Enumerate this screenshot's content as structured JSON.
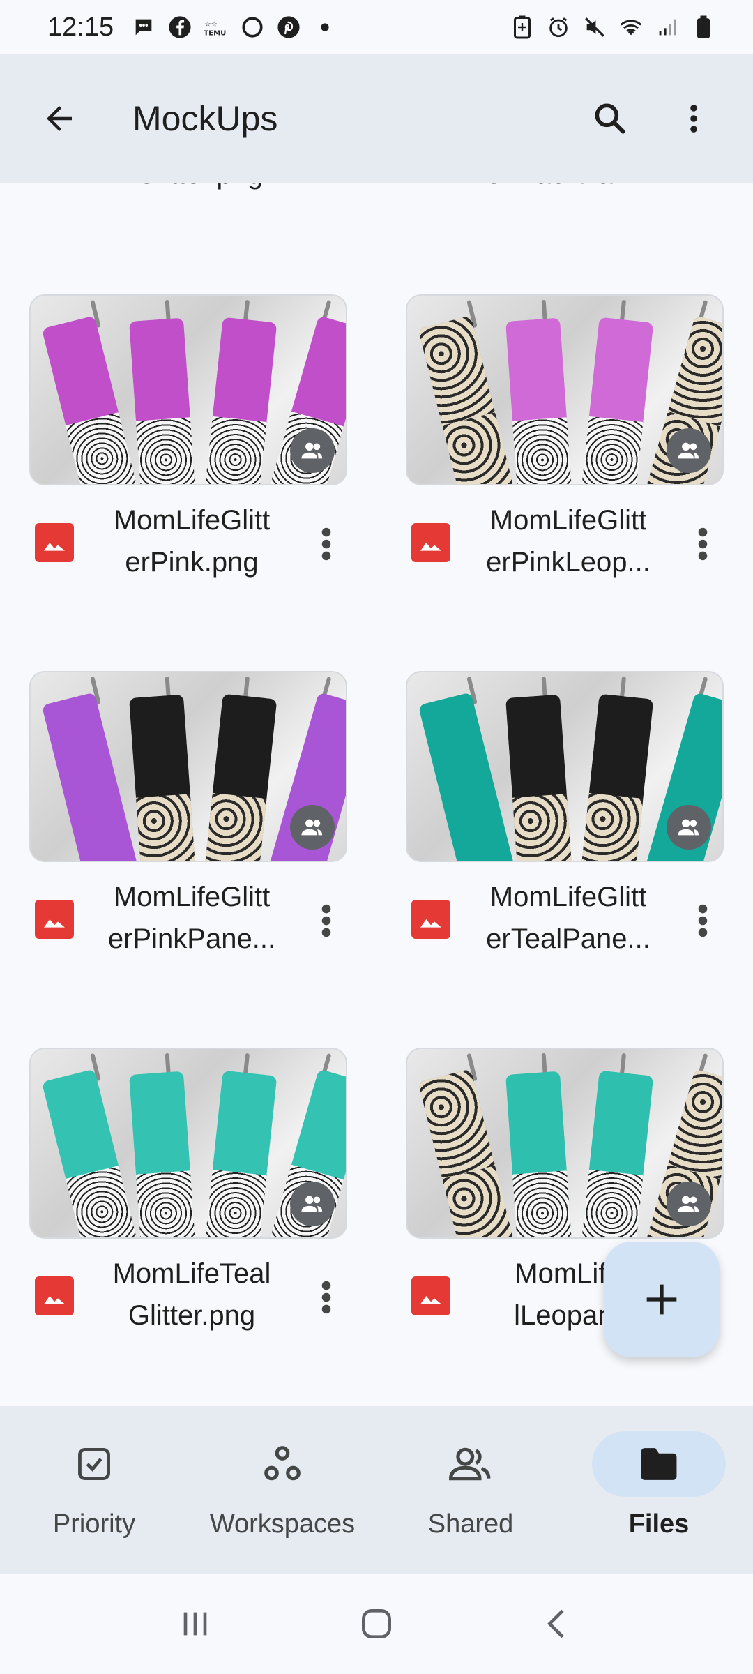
{
  "status_bar": {
    "time": "12:15",
    "notification_icons": [
      "messages-icon",
      "facebook-icon",
      "temu-icon",
      "threads-icon",
      "pinterest-icon",
      "dot-icon"
    ],
    "system_icons": [
      "battery-saver-icon",
      "alarm-icon",
      "mute-icon",
      "wifi-icon",
      "signal-icon",
      "battery-icon"
    ]
  },
  "app_bar": {
    "title": "MockUps",
    "back_icon": "arrow-back-icon",
    "search_icon": "search-icon",
    "more_icon": "more-vert-icon"
  },
  "partial_row": [
    "kGlitter.png",
    "erBlackPan..."
  ],
  "files": [
    {
      "name": "MomLifeGlitt erPink.png",
      "line1": "MomLifeGlitt",
      "line2": "erPink.png",
      "accent": "#c04fc9",
      "style": "pink"
    },
    {
      "name": "MomLifeGlitt erPinkLeop...",
      "line1": "MomLifeGlitt",
      "line2": "erPinkLeop...",
      "accent": "#d06ad6",
      "style": "pinkleopard"
    },
    {
      "name": "MomLifeGlitt erPinkPane...",
      "line1": "MomLifeGlitt",
      "line2": "erPinkPane...",
      "accent": "#a855d6",
      "style": "purplepanel"
    },
    {
      "name": "MomLifeGlitt erTealPane...",
      "line1": "MomLifeGlitt",
      "line2": "erTealPane...",
      "accent": "#13a89a",
      "style": "tealpanel"
    },
    {
      "name": "MomLifeTeal Glitter.png",
      "line1": "MomLifeTeal",
      "line2": "Glitter.png",
      "accent": "#34c2b3",
      "style": "teal"
    },
    {
      "name": "MomLife lLeopard",
      "line1": "MomLife",
      "line2": "lLeopard",
      "accent": "#2fbfae",
      "style": "tealleopard"
    }
  ],
  "fab": {
    "icon": "add-icon"
  },
  "bottom_nav": [
    {
      "label": "Priority",
      "icon": "priority-icon",
      "active": false
    },
    {
      "label": "Workspaces",
      "icon": "workspaces-icon",
      "active": false
    },
    {
      "label": "Shared",
      "icon": "shared-icon",
      "active": false
    },
    {
      "label": "Files",
      "icon": "folder-icon",
      "active": true
    }
  ],
  "system_nav": [
    "recents-icon",
    "home-icon",
    "back-icon"
  ],
  "colors": {
    "app_bar_bg": "#e6ebf2",
    "file_icon": "#e53935",
    "fab_bg": "#d3e3f6",
    "active_nav_pill": "#d3e3f6"
  }
}
